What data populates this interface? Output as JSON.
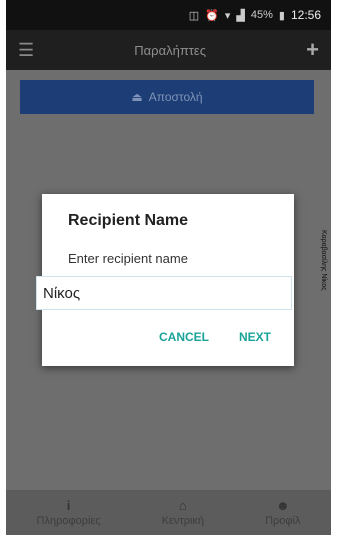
{
  "status_bar": {
    "battery": "45%",
    "time": "12:56"
  },
  "appbar": {
    "title": "Παραλήπτες",
    "menu_icon": "menu-icon",
    "add_icon": "plus-icon"
  },
  "content": {
    "send_button": "Αποστολή",
    "side_text": "Καραβασίλης Νίκος"
  },
  "dialog": {
    "title": "Recipient Name",
    "message": "Enter recipient name",
    "input_value": "Νίκος",
    "cancel_label": "CANCEL",
    "next_label": "NEXT"
  },
  "bottom_nav": [
    {
      "label": "Πληροφορίες",
      "icon": "info-icon"
    },
    {
      "label": "Κεντρική",
      "icon": "home-icon"
    },
    {
      "label": "Προφίλ",
      "icon": "people-icon"
    }
  ]
}
